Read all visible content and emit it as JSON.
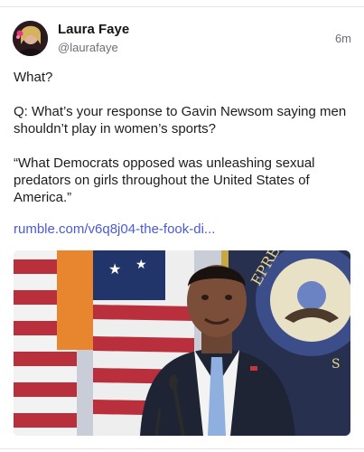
{
  "post": {
    "author_name": "Laura Faye",
    "author_handle": "@laurafaye",
    "time": "6m",
    "paragraphs": [
      "What?",
      "Q: What’s your response to Gavin Newsom saying men shouldn’t play in women’s sports?",
      "“What Democrats opposed was unleashing sexual predators on girls throughout the United States of America.”"
    ],
    "link_text": "rumble.com/v6q8j04-the-fook-di...",
    "link_color": "#4a5ad6",
    "avatar_icon": "profile-photo-icon",
    "media_icon": "video-thumbnail-image"
  }
}
